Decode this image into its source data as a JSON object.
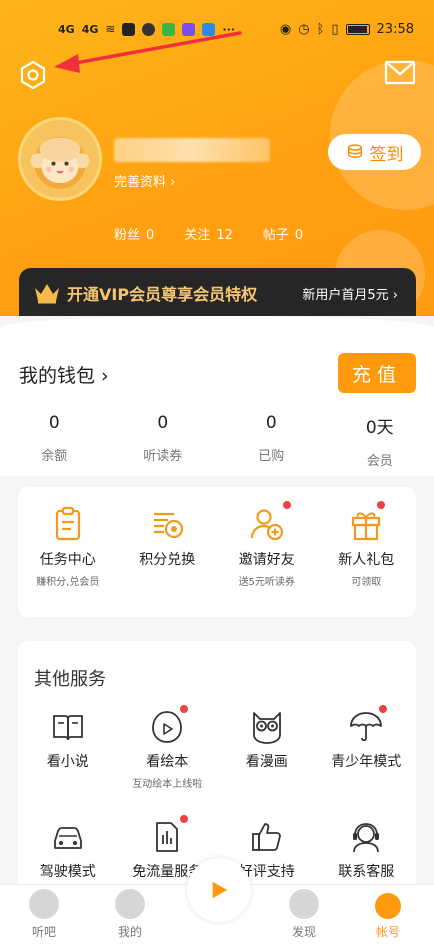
{
  "status_bar": {
    "left_signal_1": "4G",
    "left_signal_2": "4G",
    "left_more": "···",
    "time": "23:58"
  },
  "profile": {
    "complete_profile_label": "完善资料 ›",
    "signin_label": "签到",
    "stats": [
      {
        "label": "粉丝",
        "value": "0"
      },
      {
        "label": "关注",
        "value": "12"
      },
      {
        "label": "帖子",
        "value": "0"
      }
    ]
  },
  "vip": {
    "title": "开通VIP会员尊享会员特权",
    "promo": "新用户首月5元 ›"
  },
  "wallet": {
    "title": "我的钱包 ›",
    "recharge_label": "充值",
    "items": [
      {
        "value": "0",
        "label": "余额"
      },
      {
        "value": "0",
        "label": "听读券"
      },
      {
        "value": "0",
        "label": "已购"
      },
      {
        "value": "0天",
        "label": "会员"
      }
    ]
  },
  "tasks": [
    {
      "title": "任务中心",
      "sub": "赚积分,兑会员",
      "icon": "clipboard-icon",
      "dot": false
    },
    {
      "title": "积分兑换",
      "sub": "",
      "icon": "coin-exchange-icon",
      "dot": false
    },
    {
      "title": "邀请好友",
      "sub": "送5元听读券",
      "icon": "add-friend-icon",
      "dot": true
    },
    {
      "title": "新人礼包",
      "sub": "可领取",
      "icon": "gift-icon",
      "dot": true
    }
  ],
  "services": {
    "title": "其他服务",
    "items": [
      {
        "title": "看小说",
        "sub": "",
        "icon": "book-icon",
        "dot": false
      },
      {
        "title": "看绘本",
        "sub": "互动绘本上线啦",
        "icon": "picture-book-icon",
        "dot": true
      },
      {
        "title": "看漫画",
        "sub": "",
        "icon": "owl-icon",
        "dot": false
      },
      {
        "title": "青少年模式",
        "sub": "",
        "icon": "umbrella-icon",
        "dot": true
      },
      {
        "title": "驾驶模式",
        "sub": "",
        "icon": "car-icon",
        "dot": false
      },
      {
        "title": "免流量服务",
        "sub": "",
        "icon": "sim-card-icon",
        "dot": true
      },
      {
        "title": "好评支持",
        "sub": "",
        "icon": "thumbs-up-icon",
        "dot": false
      },
      {
        "title": "联系客服",
        "sub": "",
        "icon": "headset-agent-icon",
        "dot": false
      }
    ]
  },
  "nav": [
    {
      "label": "听吧"
    },
    {
      "label": "我的"
    },
    {
      "label": "发现"
    },
    {
      "label": "帐号"
    }
  ],
  "colors": {
    "accent": "#ff9a0d",
    "vip_gold": "#f6c56d",
    "dot_red": "#f04040"
  }
}
